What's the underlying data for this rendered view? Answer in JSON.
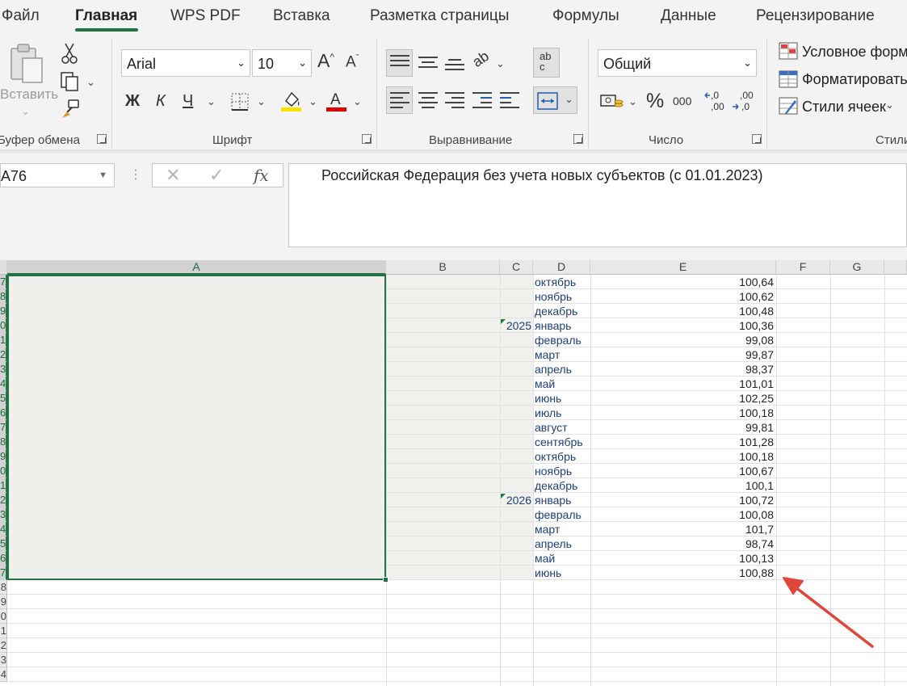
{
  "menu": {
    "tabs": [
      "Файл",
      "Главная",
      "WPS PDF",
      "Вставка",
      "Разметка страницы",
      "Формулы",
      "Данные",
      "Рецензирование"
    ],
    "active_tab": "Главная"
  },
  "ribbon": {
    "clipboard": {
      "paste_label": "Вставить",
      "group_label": "Буфер обмена"
    },
    "font": {
      "font_name": "Arial",
      "font_size": "10",
      "bold_glyph": "Ж",
      "italic_glyph": "К",
      "underline_glyph": "Ч",
      "group_label": "Шрифт",
      "fill_color": "#ffe100",
      "font_color": "#e00000"
    },
    "alignment": {
      "group_label": "Выравнивание",
      "wrap_glyph": "ab c"
    },
    "number": {
      "format": "Общий",
      "percent_glyph": "%",
      "thousands_glyph": "000",
      "dec_increase_glyph": ",0\n,00",
      "dec_decrease_glyph": ",00\n,0",
      "group_label": "Число"
    },
    "styles": {
      "conditional_label": "Условное форм",
      "format_table_label": "Форматировать",
      "cell_styles_label": "Стили ячеек",
      "group_label": "Стили"
    }
  },
  "formula_bar": {
    "name_box": "A76",
    "fx_label": "fx",
    "content": "Российская Федерация без учета новых субъектов (с 01.01.2023)"
  },
  "sheet": {
    "columns": [
      "A",
      "B",
      "C",
      "D",
      "E",
      "F",
      "G"
    ],
    "selected_column": "A",
    "row_numbers": [
      "7",
      "8",
      "9",
      "0",
      "1",
      "2",
      "3",
      "4",
      "5",
      "6",
      "7",
      "8",
      "9",
      "0",
      "1",
      "2",
      "3",
      "4",
      "5",
      "6",
      "7",
      "8",
      "9",
      "0",
      "1",
      "2",
      "3",
      "4"
    ],
    "rows": [
      {
        "c": "",
        "d": "октябрь",
        "e": "100,64"
      },
      {
        "c": "",
        "d": "ноябрь",
        "e": "100,62"
      },
      {
        "c": "",
        "d": "декабрь",
        "e": "100,48"
      },
      {
        "c": "2025",
        "d": "январь",
        "e": "100,36"
      },
      {
        "c": "",
        "d": "февраль",
        "e": "99,08"
      },
      {
        "c": "",
        "d": "март",
        "e": "99,87"
      },
      {
        "c": "",
        "d": "апрель",
        "e": "98,37"
      },
      {
        "c": "",
        "d": "май",
        "e": "101,01"
      },
      {
        "c": "",
        "d": "июнь",
        "e": "102,25"
      },
      {
        "c": "",
        "d": "июль",
        "e": "100,18"
      },
      {
        "c": "",
        "d": "август",
        "e": "99,81"
      },
      {
        "c": "",
        "d": "сентябрь",
        "e": "101,28"
      },
      {
        "c": "",
        "d": "октябрь",
        "e": "100,18"
      },
      {
        "c": "",
        "d": "ноябрь",
        "e": "100,67"
      },
      {
        "c": "",
        "d": "декабрь",
        "e": "100,1"
      },
      {
        "c": "2026",
        "d": "январь",
        "e": "100,72"
      },
      {
        "c": "",
        "d": "февраль",
        "e": "100,08"
      },
      {
        "c": "",
        "d": "март",
        "e": "101,7"
      },
      {
        "c": "",
        "d": "апрель",
        "e": "98,74"
      },
      {
        "c": "",
        "d": "май",
        "e": "100,13"
      },
      {
        "c": "",
        "d": "июнь",
        "e": "100,88"
      }
    ]
  },
  "annotation": {
    "arrow_color": "#e0463a"
  }
}
